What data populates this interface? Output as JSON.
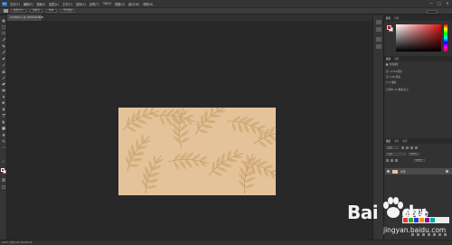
{
  "app": {
    "logo_text": "Ps",
    "menu": [
      "文件(F)",
      "编辑(E)",
      "图像(I)",
      "图层(L)",
      "文字(Y)",
      "选择(S)",
      "滤镜(T)",
      "3D(D)",
      "视图(V)",
      "窗口(W)",
      "帮助(H)"
    ],
    "window_controls": [
      "—",
      "□",
      "✕"
    ]
  },
  "options_bar": {
    "fields": [
      "取样大小:",
      "取样点",
      "样本:",
      "所有图层"
    ]
  },
  "document": {
    "tab_label": "Untitled-1 @ 100%(RGB/8)"
  },
  "tools": {
    "icons": [
      "move-icon",
      "marquee-icon",
      "lasso-icon",
      "quick-select-icon",
      "crop-icon",
      "eyedropper-icon",
      "healing-icon",
      "brush-icon",
      "stamp-icon",
      "history-brush-icon",
      "eraser-icon",
      "gradient-icon",
      "blur-icon",
      "dodge-icon",
      "pen-icon",
      "type-icon",
      "path-select-icon",
      "shape-icon",
      "hand-icon",
      "zoom-icon",
      "more-icon",
      "swap-icon"
    ],
    "fg_color": "#d01010",
    "bg_color": "#ffffff"
  },
  "panels": {
    "color": {
      "tabs": [
        "颜色",
        "色板"
      ]
    },
    "adjustments": {
      "tabs": [
        "属性",
        "调整"
      ],
      "title": "■ 文档属性",
      "rows": [
        "宽: 17.64 厘米",
        "高: 9.89 厘米",
        "X: 0 像素",
        "分辨率: 72 像素/英寸"
      ]
    },
    "layers": {
      "tabs": [
        "图层",
        "通道",
        "路径"
      ],
      "filter_label": "类型",
      "blend_mode": "正常",
      "opacity": "100%",
      "fill": "100%",
      "layer_name": "背景"
    }
  },
  "status": {
    "text": "100%     文档:223.5K/223.5K"
  },
  "watermark": {
    "brand": "Bai",
    "brand2": "du",
    "jy": "经验",
    "url": "jingyan.baidu.com"
  },
  "colors": {
    "canvas_fill": "#e4c39a",
    "app_bg": "#282828",
    "panel_bg": "#323232"
  }
}
